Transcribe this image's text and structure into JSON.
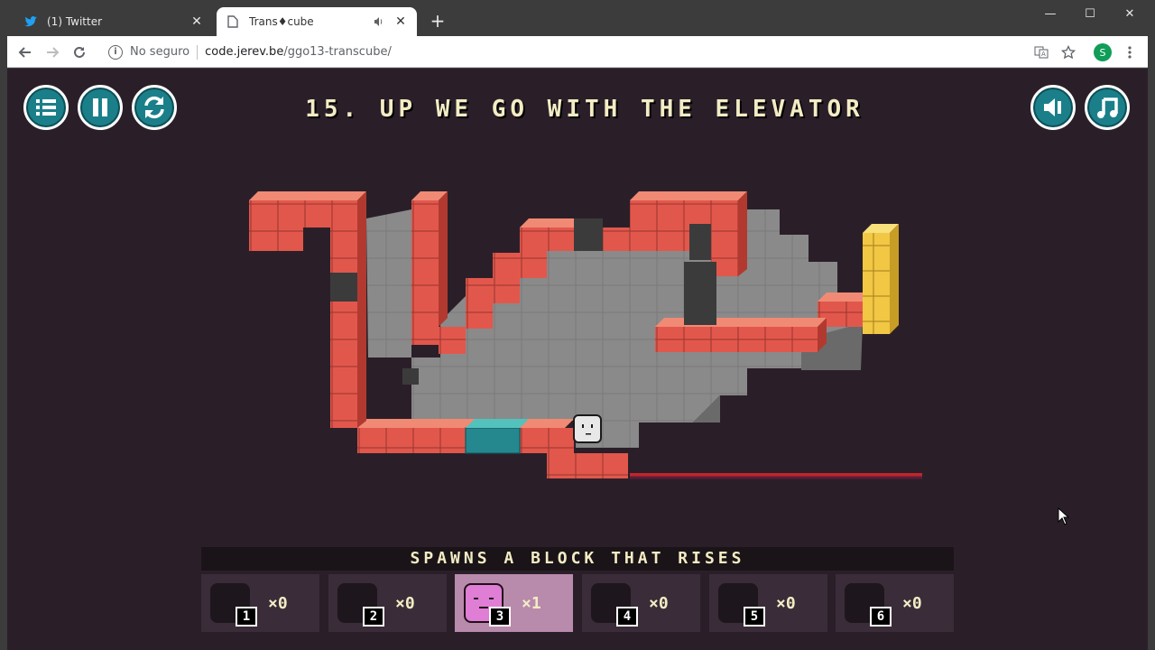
{
  "browser": {
    "tabs": [
      {
        "title": "(1) Twitter",
        "icon": "twitter-icon",
        "active": false
      },
      {
        "title": "Trans♦cube",
        "icon": "page-icon",
        "active": true
      }
    ],
    "new_tab": "+",
    "window_controls": {
      "minimize": "—",
      "maximize": "☐",
      "close": "✕"
    },
    "address": {
      "security_label": "No seguro",
      "host": "code.jerev.be",
      "path": "/ggo13-transcube/"
    },
    "profile_initial": "S"
  },
  "game": {
    "level_title": "15. UP WE GO WITH THE ELEVATOR",
    "buttons": {
      "menu": "list-icon",
      "pause": "pause-icon",
      "restart": "restart-icon",
      "sound": "speaker-icon",
      "music": "music-note-icon"
    },
    "hint": "SPAWNS A BLOCK THAT RISES",
    "inventory": [
      {
        "slot": "1",
        "count": "×0",
        "selected": false
      },
      {
        "slot": "2",
        "count": "×0",
        "selected": false
      },
      {
        "slot": "3",
        "count": "×1",
        "selected": true
      },
      {
        "slot": "4",
        "count": "×0",
        "selected": false
      },
      {
        "slot": "5",
        "count": "×0",
        "selected": false
      },
      {
        "slot": "6",
        "count": "×0",
        "selected": false
      }
    ],
    "colors": {
      "background": "#2a1f29",
      "wall_block": "#e2574c",
      "floor_tile": "#8c8c8c",
      "dark_block": "#3b3b3b",
      "teal_block": "#26888f",
      "goal_block": "#f2c744",
      "player": "#e8e8e8",
      "selected_slot": "#b88aac",
      "spawn_block": "#e07dd5"
    }
  }
}
